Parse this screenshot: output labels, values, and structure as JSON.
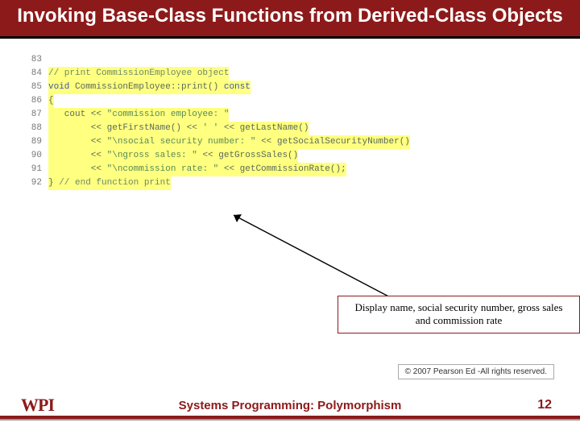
{
  "title": "Invoking Base-Class Functions from Derived-Class Objects",
  "code": {
    "l83": "",
    "l84": "// print CommissionEmployee object",
    "l85_a": "void",
    "l85_b": " CommissionEmployee::print() ",
    "l85_c": "const",
    "l86": "{",
    "l87_a": "   cout << ",
    "l87_b": "\"commission employee: \"",
    "l88_a": "        << getFirstName() << ",
    "l88_b": "' '",
    "l88_c": " << getLastName()",
    "l89_a": "        << ",
    "l89_b": "\"\\nsocial security number: \"",
    "l89_c": " << getSocialSecurityNumber()",
    "l90_a": "        << ",
    "l90_b": "\"\\ngross sales: \"",
    "l90_c": " << getGrossSales()",
    "l91_a": "        << ",
    "l91_b": "\"\\ncommission rate: \"",
    "l91_c": " << getCommissionRate();",
    "l92_a": "} ",
    "l92_b": "// end function print"
  },
  "line_numbers": {
    "n83": "83",
    "n84": "84",
    "n85": "85",
    "n86": "86",
    "n87": "87",
    "n88": "88",
    "n89": "89",
    "n90": "90",
    "n91": "91",
    "n92": "92"
  },
  "callout": "Display name, social security number, gross sales and commission rate",
  "copyright": "© 2007 Pearson Ed -All rights reserved.",
  "footer": {
    "logo": "WPI",
    "title": "Systems Programming:  Polymorphism",
    "page": "12"
  }
}
